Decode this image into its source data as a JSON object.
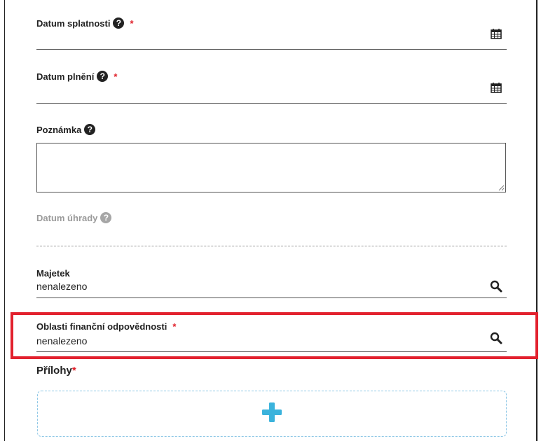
{
  "fields": {
    "due_date": {
      "label": "Datum splatnosti",
      "required_mark": "*",
      "icon": "calendar-icon"
    },
    "fulfillment_date": {
      "label": "Datum plnění",
      "required_mark": "*",
      "icon": "calendar-icon"
    },
    "note": {
      "label": "Poznámka",
      "value": ""
    },
    "payment_date": {
      "label": "Datum úhrady",
      "state": "disabled"
    },
    "property": {
      "label": "Majetek",
      "value": "nenalezeno",
      "icon": "search-icon"
    },
    "financial_area": {
      "label": "Oblasti finanční odpovědnosti",
      "required_mark": "*",
      "value": "nenalezeno",
      "icon": "search-icon",
      "highlighted": true
    }
  },
  "attachments": {
    "title": "Přílohy",
    "required_mark": "*",
    "icon": "plus-icon"
  },
  "help_icon_glyph": "?",
  "colors": {
    "required": "#e0202a",
    "highlight_border": "#e2212e",
    "plus": "#3bb3dc",
    "upload_border": "#8ec7e6",
    "disabled_text": "#9a9a9a"
  }
}
